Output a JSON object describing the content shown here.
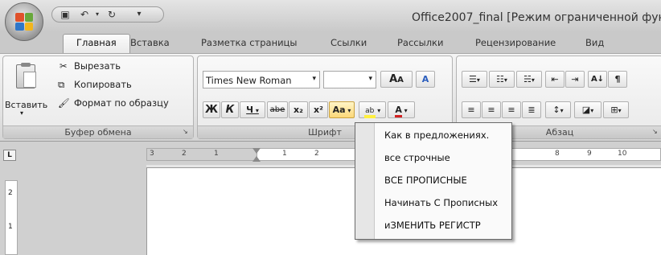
{
  "window": {
    "title": "Office2007_final [Режим ограниченной функ"
  },
  "tabs": [
    {
      "label": "Главная",
      "active": true
    },
    {
      "label": "Вставка"
    },
    {
      "label": "Разметка страницы"
    },
    {
      "label": "Ссылки"
    },
    {
      "label": "Рассылки"
    },
    {
      "label": "Рецензирование"
    },
    {
      "label": "Вид"
    }
  ],
  "clipboard": {
    "paste_label": "Вставить",
    "cut_label": "Вырезать",
    "copy_label": "Копировать",
    "format_painter_label": "Формат по образцу",
    "group_label": "Буфер обмена"
  },
  "font": {
    "font_name": "Times New Roman",
    "font_size": "",
    "bold": "Ж",
    "italic": "К",
    "underline": "Ч",
    "strikethrough": "abe",
    "subscript": "x₂",
    "superscript": "x²",
    "change_case": "Aa",
    "grow": "A",
    "shrink": "A",
    "clear": "A",
    "group_label": "Шрифт"
  },
  "paragraph": {
    "group_label": "Абзац",
    "sort": "А↓",
    "pilcrow": "¶"
  },
  "ruler": {
    "ticks": [
      "3",
      "2",
      "1",
      "1",
      "2",
      "8",
      "9",
      "10"
    ],
    "corner": "L",
    "vertical_ticks": [
      "2",
      "1"
    ]
  },
  "change_case_menu": {
    "items": [
      {
        "label": "Как в предложениях.",
        "mnemonic": "п"
      },
      {
        "label": "все строчные",
        "mnemonic": "е"
      },
      {
        "label": "ВСЕ ПРОПИСНЫЕ",
        "mnemonic": "В"
      },
      {
        "label": "Начинать С Прописных",
        "mnemonic": "Н"
      },
      {
        "label": "иЗМЕНИТЬ РЕГИСТР",
        "mnemonic": "М"
      }
    ]
  },
  "colors": {
    "highlight": "#ffef3f",
    "font_color": "#d22020",
    "logo_red": "#e0522b",
    "logo_green": "#68a83b",
    "logo_blue": "#2f77c9",
    "logo_yellow": "#f2b51c"
  }
}
